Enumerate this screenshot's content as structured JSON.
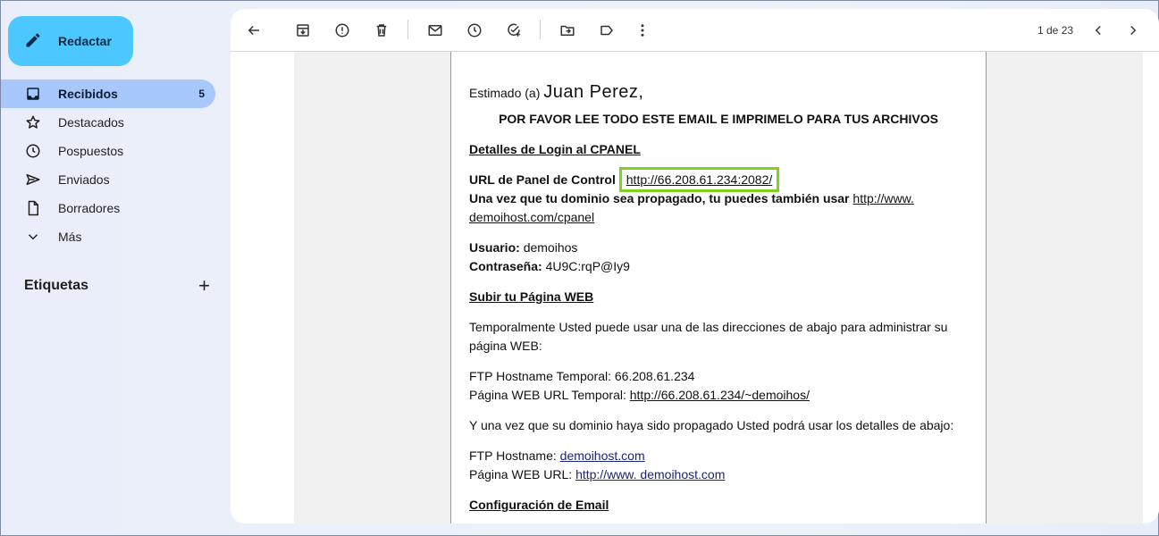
{
  "compose": {
    "label": "Redactar"
  },
  "nav": {
    "items": [
      {
        "label": "Recibidos",
        "count": "5",
        "icon": "inbox-icon"
      },
      {
        "label": "Destacados",
        "icon": "star-icon"
      },
      {
        "label": "Pospuestos",
        "icon": "clock-icon"
      },
      {
        "label": "Enviados",
        "icon": "send-icon"
      },
      {
        "label": "Borradores",
        "icon": "draft-icon"
      },
      {
        "label": "Más",
        "icon": "chevron-down-icon"
      }
    ]
  },
  "labels": {
    "heading": "Etiquetas",
    "add": "+"
  },
  "toolbar": {
    "pager": "1 de 23"
  },
  "email": {
    "greeting_prefix": "Estimado (a)",
    "greeting_name": "Juan Perez,",
    "notice": "POR FAVOR LEE TODO ESTE EMAIL E IMPRIMELO PARA TUS ARCHIVOS",
    "login_heading": "Detalles de Login al CPANEL",
    "panel_url_label": "URL de Panel de Control",
    "panel_url": "http://66.208.61.234:2082/",
    "propagated_text": "Una vez que tu dominio sea propagado, tu puedes también usar",
    "propagated_url_1": "http://www.",
    "propagated_url_2": "demoihost.com/cpanel",
    "user_label": "Usuario:",
    "user_value": "demoihos",
    "pass_label": "Contraseña:",
    "pass_value": "4U9C:rqP@Iy9",
    "upload_heading": "Subir tu Página WEB",
    "temp_text": "Temporalmente Usted puede usar una de las direcciones de abajo para administrar su página WEB:",
    "ftp_temp_label": "FTP Hostname Temporal:",
    "ftp_temp_value": "66.208.61.234",
    "web_temp_label": "Página WEB URL Temporal:",
    "web_temp_url": "http://66.208.61.234/~demoihos/",
    "after_prop_text": "Y una vez que su dominio haya sido propagado Usted podrá usar los detalles de abajo:",
    "ftp_label": "FTP Hostname:",
    "ftp_value": "demoihost.com",
    "web_label": "Página WEB URL:",
    "web_url": "http://www. demoihost.com",
    "email_heading": "Configuración de Email"
  },
  "colors": {
    "compose_bg": "#4cc7ff",
    "active_nav_bg": "#a8c7fa",
    "highlight": "#7ed321"
  }
}
